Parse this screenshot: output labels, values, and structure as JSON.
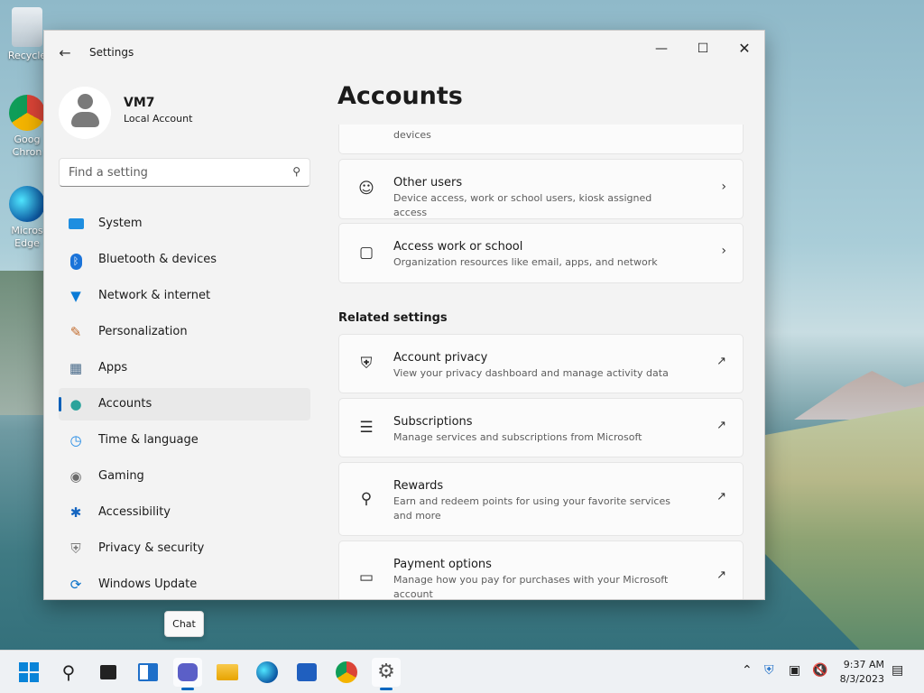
{
  "desktop": {
    "icons": [
      {
        "label": "Recycle"
      },
      {
        "label": "Goog Chron"
      },
      {
        "label": "Micros Edge"
      }
    ]
  },
  "window": {
    "title": "Settings",
    "back_icon": "back-arrow-icon",
    "controls": [
      "minimize",
      "maximize",
      "close"
    ]
  },
  "user": {
    "name": "VM7",
    "account_type": "Local Account"
  },
  "search": {
    "placeholder": "Find a setting",
    "value": ""
  },
  "nav": {
    "items": [
      {
        "label": "System",
        "icon": "monitor-icon",
        "color": "#0078d4"
      },
      {
        "label": "Bluetooth & devices",
        "icon": "bluetooth-icon",
        "color": "#0078d4"
      },
      {
        "label": "Network & internet",
        "icon": "wifi-icon",
        "color": "#0a7bd6"
      },
      {
        "label": "Personalization",
        "icon": "brush-icon",
        "color": "#c26a2b"
      },
      {
        "label": "Apps",
        "icon": "apps-icon",
        "color": "#4a6b8a"
      },
      {
        "label": "Accounts",
        "icon": "person-icon",
        "color": "#2ba39b"
      },
      {
        "label": "Time & language",
        "icon": "globe-clock-icon",
        "color": "#1e88e5"
      },
      {
        "label": "Gaming",
        "icon": "gamepad-icon",
        "color": "#6b6b6b"
      },
      {
        "label": "Accessibility",
        "icon": "accessibility-icon",
        "color": "#1565c0"
      },
      {
        "label": "Privacy & security",
        "icon": "shield-icon",
        "color": "#7d7d7d"
      },
      {
        "label": "Windows Update",
        "icon": "update-icon",
        "color": "#0b72c9"
      }
    ],
    "active": "Accounts"
  },
  "main": {
    "title": "Accounts",
    "partial_card_desc": "devices",
    "cards": [
      {
        "title": "Other users",
        "desc": "Device access, work or school users, kiosk assigned access",
        "icon": "add-user-icon",
        "action": "chevron-right-icon"
      },
      {
        "title": "Access work or school",
        "desc": "Organization resources like email, apps, and network",
        "icon": "briefcase-icon",
        "action": "chevron-right-icon"
      }
    ],
    "related_heading": "Related settings",
    "related": [
      {
        "title": "Account privacy",
        "desc": "View your privacy dashboard and manage activity data",
        "icon": "shield-outline-icon",
        "action": "external-link-icon"
      },
      {
        "title": "Subscriptions",
        "desc": "Manage services and subscriptions from Microsoft",
        "icon": "subscriptions-icon",
        "action": "external-link-icon"
      },
      {
        "title": "Rewards",
        "desc": "Earn and redeem points for using your favorite services and more",
        "icon": "trophy-icon",
        "action": "external-link-icon"
      },
      {
        "title": "Payment options",
        "desc": "Manage how you pay for purchases with your Microsoft account",
        "icon": "credit-card-icon",
        "action": "external-link-icon"
      }
    ]
  },
  "taskbar": {
    "tooltip": "Chat",
    "apps": [
      "start-icon",
      "search-icon",
      "task-view-icon",
      "widgets-icon",
      "chat-icon",
      "file-explorer-icon",
      "edge-icon",
      "store-icon",
      "chrome-icon",
      "settings-icon"
    ],
    "time": "9:37 AM",
    "date": "8/3/2023"
  }
}
